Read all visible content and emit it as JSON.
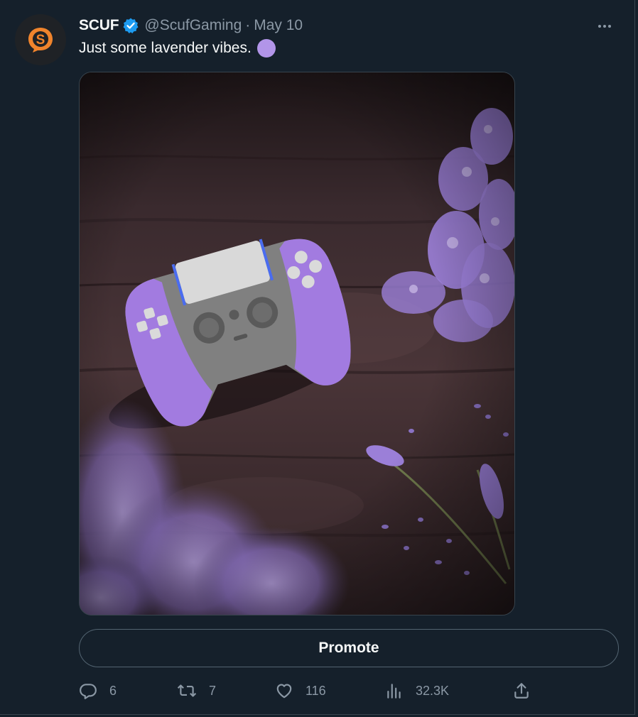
{
  "tweet": {
    "author": {
      "display_name": "SCUF",
      "handle": "@ScufGaming",
      "verified": true,
      "avatar_icon": "scuf-logo-icon",
      "avatar_color": "#f0842c"
    },
    "separator": "·",
    "date": "May 10",
    "text": "Just some lavender vibes.",
    "emoji": "purple-circle-emoji",
    "media": {
      "description_icon": "controller-lavender-photo",
      "controller_color": "#a27be0",
      "flower_color": "#9b7fd8"
    },
    "promote_label": "Promote",
    "actions": {
      "reply": {
        "icon": "reply-icon",
        "count": "6"
      },
      "retweet": {
        "icon": "retweet-icon",
        "count": "7"
      },
      "like": {
        "icon": "heart-icon",
        "count": "116"
      },
      "views": {
        "icon": "views-chart-icon",
        "count": "32.3K"
      },
      "share": {
        "icon": "share-icon"
      }
    }
  },
  "colors": {
    "background": "#15202b",
    "secondary_text": "#8b98a5",
    "verified_blue": "#1d9bf0",
    "border": "#38444d"
  }
}
